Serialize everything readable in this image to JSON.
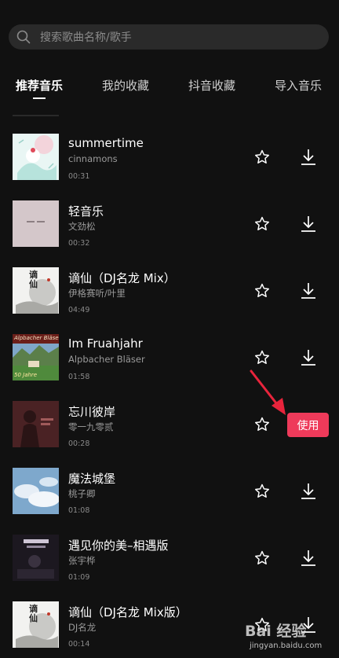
{
  "search": {
    "placeholder": "搜索歌曲名称/歌手"
  },
  "tabs": [
    {
      "label": "推荐音乐",
      "active": true
    },
    {
      "label": "我的收藏",
      "active": false
    },
    {
      "label": "抖音收藏",
      "active": false
    },
    {
      "label": "导入音乐",
      "active": false
    }
  ],
  "songs": [
    {
      "title": "summertime",
      "artist": "cinnamons",
      "duration": "00:31",
      "action": "download"
    },
    {
      "title": "轻音乐",
      "artist": "文劲松",
      "duration": "00:32",
      "action": "download"
    },
    {
      "title": "谪仙（DJ名龙 Mix）",
      "artist": "伊格赛听/叶里",
      "duration": "04:49",
      "action": "download"
    },
    {
      "title": "Im Fruahjahr",
      "artist": "Alpbacher Bläser",
      "duration": "01:58",
      "action": "download"
    },
    {
      "title": "忘川彼岸",
      "artist": "零一九零贰",
      "duration": "00:28",
      "action": "use",
      "use_label": "使用"
    },
    {
      "title": "魔法城堡",
      "artist": "桃子卿",
      "duration": "01:08",
      "action": "download"
    },
    {
      "title": "遇见你的美–相遇版",
      "artist": "张宇桦",
      "duration": "01:09",
      "action": "download"
    },
    {
      "title": "谪仙（DJ名龙 Mix版）",
      "artist": "DJ名龙",
      "duration": "00:14",
      "action": "download"
    }
  ],
  "cover_art_text": {
    "song_2": "谪仙",
    "song_3": "Alpbacher Bläser",
    "song_3_badge": "50 Jahre",
    "song_7": "谪仙"
  },
  "watermark": {
    "brand": "Bai 经验",
    "url": "jingyan.baidu.com"
  },
  "colors": {
    "accent": "#ee3a5a",
    "background": "#111111",
    "search_bg": "#2a2a2a"
  }
}
